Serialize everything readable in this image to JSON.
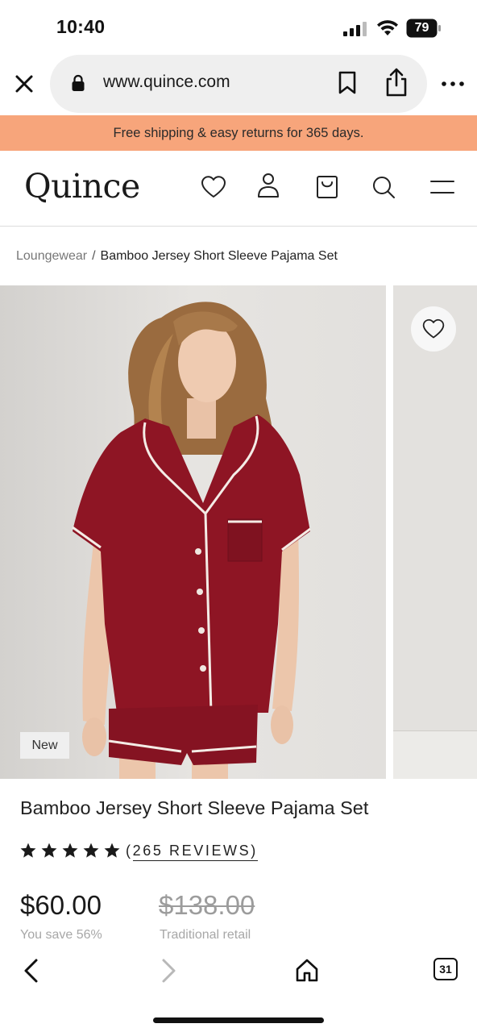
{
  "status_bar": {
    "time": "10:40",
    "battery": "79"
  },
  "browser": {
    "url": "www.quince.com",
    "icons": [
      "close-icon",
      "lock-icon",
      "bookmark-icon",
      "share-icon",
      "more-icon"
    ]
  },
  "promo": {
    "text": "Free shipping & easy returns for 365 days."
  },
  "header": {
    "logo": "Quince",
    "icons": [
      "heart-icon",
      "account-icon",
      "cart-icon",
      "search-icon",
      "menu-icon"
    ]
  },
  "breadcrumb": {
    "parent": "Loungewear",
    "separator": "/",
    "current": "Bamboo Jersey Short Sleeve Pajama Set"
  },
  "gallery": {
    "badge": "New"
  },
  "product": {
    "title": "Bamboo Jersey Short Sleeve Pajama Set",
    "rating": 5,
    "reviews_open": "(",
    "reviews_text": "265 REVIEWS)",
    "price": "$60.00",
    "savings": "You save 56%",
    "original_price": "$138.00",
    "original_label": "Traditional retail"
  },
  "toolbar": {
    "tabs_count": "31"
  },
  "colors": {
    "promo_bg": "#f7a57b",
    "garment": "#8e1524"
  }
}
